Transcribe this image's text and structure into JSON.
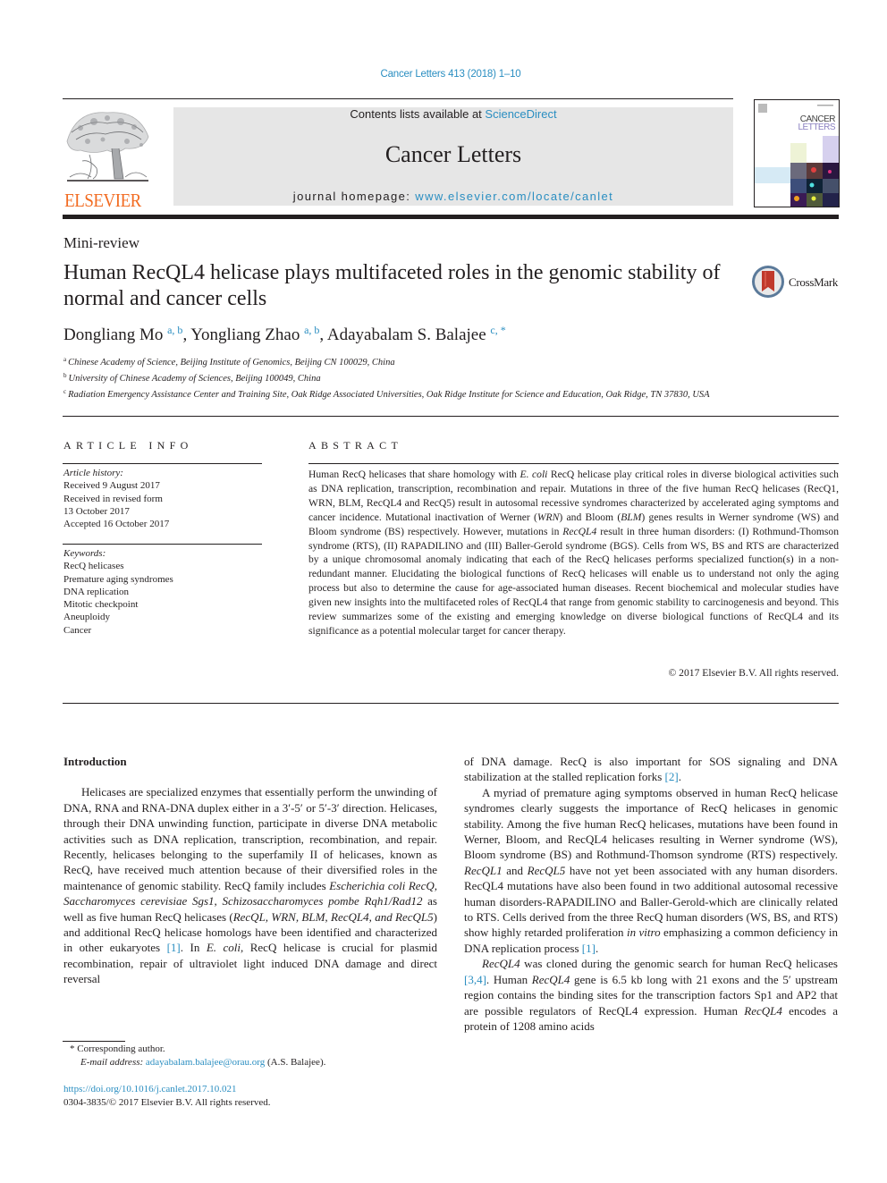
{
  "journal_reference": "Cancer Letters 413 (2018) 1–10",
  "header": {
    "publisher_logo_text": "ELSEVIER",
    "contents_prefix": "Contents lists available at ",
    "contents_link": "ScienceDirect",
    "journal_title": "Cancer Letters",
    "homepage_prefix": "journal homepage: ",
    "homepage_link": "www.elsevier.com/locate/canlet",
    "cover_title_line1": "CANCER",
    "cover_title_line2": "LETTERS"
  },
  "article": {
    "type": "Mini-review",
    "title": "Human RecQL4 helicase plays multifaceted roles in the genomic stability of normal and cancer cells",
    "crossmark_label": "CrossMark",
    "authors": [
      {
        "name": "Dongliang Mo",
        "affil": "a, b",
        "sep": ", "
      },
      {
        "name": "Yongliang Zhao",
        "affil": "a, b",
        "sep": ", "
      },
      {
        "name": "Adayabalam S. Balajee",
        "affil": "c, *",
        "sep": ""
      }
    ],
    "affiliations": [
      {
        "key": "a",
        "text": "Chinese Academy of Science, Beijing Institute of Genomics, Beijing CN 100029, China"
      },
      {
        "key": "b",
        "text": "University of Chinese Academy of Sciences, Beijing 100049, China"
      },
      {
        "key": "c",
        "text": "Radiation Emergency Assistance Center and Training Site, Oak Ridge Associated Universities, Oak Ridge Institute for Science and Education, Oak Ridge, TN 37830, USA"
      }
    ]
  },
  "article_info": {
    "heading": "ARTICLE INFO",
    "history_label": "Article history:",
    "history": [
      "Received 9 August 2017",
      "Received in revised form",
      "13 October 2017",
      "Accepted 16 October 2017"
    ],
    "keywords_label": "Keywords:",
    "keywords": [
      "RecQ helicases",
      "Premature aging syndromes",
      "DNA replication",
      "Mitotic checkpoint",
      "Aneuploidy",
      "Cancer"
    ]
  },
  "abstract": {
    "heading": "ABSTRACT",
    "segments": [
      {
        "t": "Human RecQ helicases that share homology with "
      },
      {
        "t": "E. coli",
        "i": true
      },
      {
        "t": " RecQ helicase play critical roles in diverse bio­logical activities such as DNA replication, transcription, recombination and repair. Mutations in three of the five human RecQ helicases (RecQ1, WRN, BLM, RecQL4 and RecQ5) result in autosomal recessive syndromes characterized by accelerated aging symptoms and cancer incidence. Mutational inactivation of Werner ("
      },
      {
        "t": "WRN",
        "i": true
      },
      {
        "t": ") and Bloom ("
      },
      {
        "t": "BLM",
        "i": true
      },
      {
        "t": ") genes results in Werner syndrome (WS) and Bloom syndrome (BS) respectively. However, mutations in "
      },
      {
        "t": "RecQL4",
        "i": true
      },
      {
        "t": " result in three human disorders: (I) Rothmund-Thomson syndrome (RTS), (II) RAPADILINO and (III) Baller-Gerold syndrome (BGS). Cells from WS, BS and RTS are characterized by a unique chromosomal anomaly indicating that each of the RecQ helicases performs specialized function(s) in a non-redundant manner. Elucidating the biological functions of RecQ helicases will enable us to understand not only the aging process but also to determine the cause for age-associated human diseases. Recent biochemical and molecular studies have given new insights into the multifaceted roles of RecQL4 that range from genomic stability to carcinogenesis and beyond. This review summarizes some of the existing and emerging knowledge on diverse biological functions of RecQL4 and its significance as a potential molecular target for cancer therapy."
      }
    ],
    "copyright": "© 2017 Elsevier B.V. All rights reserved."
  },
  "body": {
    "section_title": "Introduction",
    "left_paragraphs": [
      [
        {
          "t": "Helicases are specialized enzymes that essentially perform the unwinding of DNA, RNA and RNA-DNA duplex either in a 3′-5′ or 5′-3′ direction. Helicases, through their DNA unwinding function, participate in diverse DNA metabolic activities such as DNA repli­cation, transcription, recombination, and repair. Recently, helicases belonging to the superfamily II of helicases, known as RecQ, have received much attention because of their diversified roles in the maintenance of genomic stability. RecQ family includes "
        },
        {
          "t": "Escherichia coli RecQ, Saccharomyces cerevisiae Sgs1, Schizosaccharomyces pombe Rqh1/Rad12",
          "i": true
        },
        {
          "t": " as well as five human RecQ helicases ("
        },
        {
          "t": "RecQL, WRN, BLM, RecQL4, and RecQL5",
          "i": true
        },
        {
          "t": ") and additional RecQ helicase ho­mologs have been identified and characterized in other eukaryotes "
        },
        {
          "t": "[1]",
          "c": true
        },
        {
          "t": ". In "
        },
        {
          "t": "E. coli",
          "i": true
        },
        {
          "t": ", RecQ helicase is crucial for plasmid recombination, repair of ultraviolet light induced DNA damage and direct reversal"
        }
      ]
    ],
    "right_paragraphs": [
      [
        {
          "t": "of DNA damage. RecQ is also important for SOS signaling and DNA stabilization at the stalled replication forks "
        },
        {
          "t": "[2]",
          "c": true
        },
        {
          "t": "."
        }
      ],
      [
        {
          "t": "A myriad of premature aging symptoms observed in human RecQ helicase syndromes clearly suggests the importance of RecQ helicases in genomic stability. Among the five human RecQ heli­cases, mutations have been found in Werner, Bloom, and RecQL4 helicases resulting in Werner syndrome (WS), Bloom syndrome (BS) and Rothmund-Thomson syndrome (RTS) respectively. "
        },
        {
          "t": "RecQL1",
          "i": true
        },
        {
          "t": " and "
        },
        {
          "t": "RecQL5",
          "i": true
        },
        {
          "t": " have not yet been associated with any human disorders. RecQL4 mutations have also been found in two additional auto­somal recessive human disorders-RAPADILINO and Baller-Gerold-which are clinically related to RTS. Cells derived from the three RecQ human disorders (WS, BS, and RTS) show highly retarded proliferation "
        },
        {
          "t": "in vitro",
          "i": true
        },
        {
          "t": " emphasizing a common deficiency in DNA replication process "
        },
        {
          "t": "[1]",
          "c": true
        },
        {
          "t": "."
        }
      ],
      [
        {
          "t": "RecQL4",
          "i": true
        },
        {
          "t": " was cloned during the genomic search for human RecQ helicases "
        },
        {
          "t": "[3,4]",
          "c": true
        },
        {
          "t": ". Human "
        },
        {
          "t": "RecQL4",
          "i": true
        },
        {
          "t": " gene is 6.5 kb long with 21 exons and the 5′ upstream region contains the binding sites for the tran­scription factors Sp1 and AP2 that are possible regulators of RecQL4 expression. Human "
        },
        {
          "t": "RecQL4",
          "i": true
        },
        {
          "t": " encodes a protein of 1208 amino acids"
        }
      ]
    ]
  },
  "footnotes": {
    "corresponding_marker": "*",
    "corresponding_label": "Corresponding author.",
    "email_label": "E-mail address:",
    "email": "adayabalam.balajee@orau.org",
    "email_owner": "(A.S. Balajee).",
    "doi": "https://doi.org/10.1016/j.canlet.2017.10.021",
    "issn_line": "0304-3835/© 2017 Elsevier B.V. All rights reserved."
  },
  "colors": {
    "link": "#2a8ec1",
    "elsevier_orange": "#f26b21",
    "masthead_bg": "#e6e6e6",
    "text": "#231f20"
  }
}
